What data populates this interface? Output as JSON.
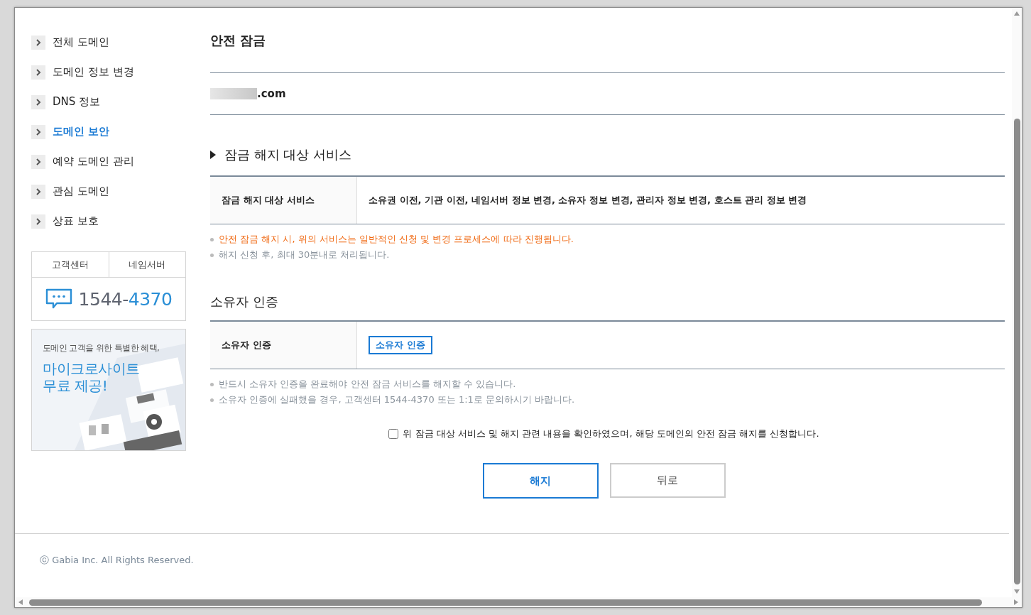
{
  "sidebar": {
    "items": [
      {
        "label": "전체 도메인",
        "selected": false
      },
      {
        "label": "도메인 정보 변경",
        "selected": false
      },
      {
        "label": "DNS 정보",
        "selected": false
      },
      {
        "label": "도메인 보안",
        "selected": true
      },
      {
        "label": "예약 도메인 관리",
        "selected": false
      },
      {
        "label": "관심 도메인",
        "selected": false
      },
      {
        "label": "상표 보호",
        "selected": false
      }
    ],
    "contact": {
      "tabs": [
        {
          "label": "고객센터"
        },
        {
          "label": "네임서버"
        }
      ],
      "phone_prefix": "1544-",
      "phone_suffix": "4370"
    },
    "banner": {
      "kind": "picture",
      "line": "도메인 고객을 위한 특별한 혜택,",
      "headline_1": "마이크로사이트",
      "headline_2": "무료 제공!"
    }
  },
  "page": {
    "title": "안전 잠금",
    "domain": ".com",
    "services_section": {
      "title": "잠금 해지 대상 서비스",
      "row_label": "잠금 해지 대상 서비스",
      "row_value": "소유권 이전, 기관 이전, 네임서버 정보 변경, 소유자 정보 변경, 관리자 정보 변경, 호스트 관리 정보 변경",
      "notes": [
        {
          "text": "안전 잠금 해지 시, 위의 서비스는 일반적인 신청 및 변경 프로세스에 따라 진행됩니다.",
          "kind": "warning"
        },
        {
          "text": "해지 신청 후, 최대 30분내로 처리됩니다.",
          "kind": "info"
        }
      ]
    },
    "owner_section": {
      "title": "소유자 인증",
      "row_label": "소유자 인증",
      "button": "소유자 인증",
      "notes": [
        {
          "text": "반드시 소유자 인증을 완료해야 안전 잠금 서비스를 해지할 수 있습니다.",
          "kind": "info"
        },
        {
          "text": "소유자 인증에 실패했을 경우, 고객센터 1544-4370 또는 1:1로 문의하시기 바랍니다.",
          "kind": "info"
        }
      ]
    },
    "agree": {
      "label": "위 잠금 대상 서비스 및 해지 관련 내용을 확인하였으며, 해당 도메인의 안전 잠금 해지를 신청합니다.",
      "checked": false
    },
    "buttons": [
      {
        "label": "해지",
        "kind": "primary"
      },
      {
        "label": "뒤로",
        "kind": "secondary"
      }
    ]
  },
  "footer": {
    "copyright": "ⓒ Gabia Inc. All Rights Reserved."
  }
}
